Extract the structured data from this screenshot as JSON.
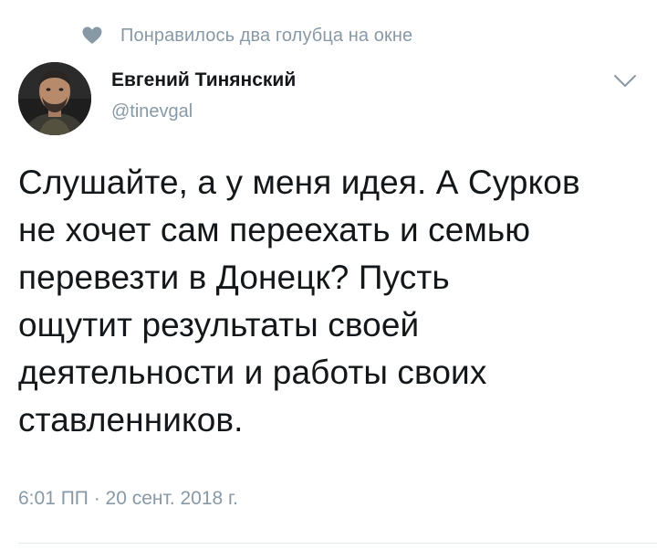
{
  "social_context": {
    "icon": "heart-icon",
    "text": "Понравилось два голубца на окне"
  },
  "author": {
    "name": "Евгений Тинянский",
    "handle": "@tinevgal",
    "avatar": "avatar-photo"
  },
  "menu": {
    "icon": "chevron-down-icon"
  },
  "tweet": {
    "lines": [
      "Слушайте, а у меня идея. А Сурков",
      "не хочет сам переехать и семью",
      "перевезти в Донецк? Пусть",
      "ощутит результаты своей",
      "деятельности и работы своих",
      "ставленников."
    ],
    "timestamp": "6:01 ПП · 20 сент. 2018 г."
  },
  "colors": {
    "primary_text": "#14171a",
    "secondary_text": "#8899a6",
    "divider": "#e1e8ed",
    "background": "#ffffff"
  }
}
